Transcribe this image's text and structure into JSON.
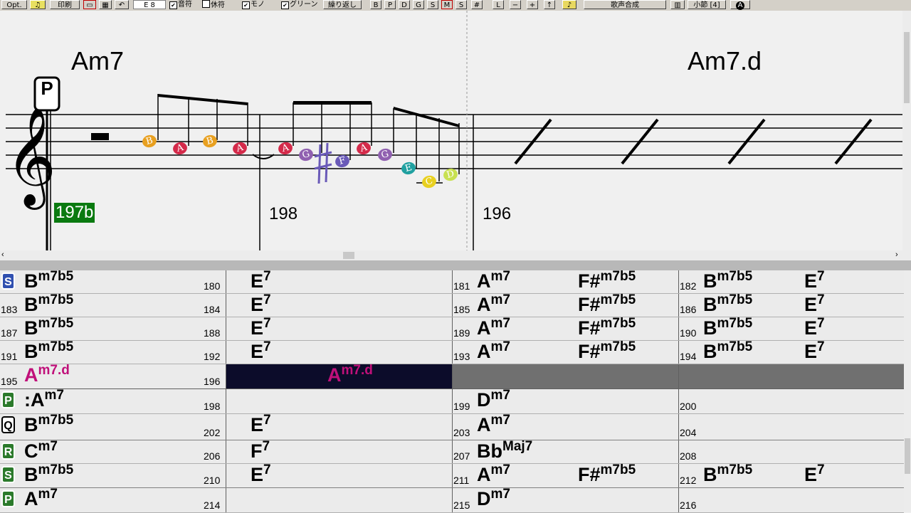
{
  "toolbar": {
    "opt_label": "Opt.",
    "print_label": "印刷",
    "key_value": "E 8",
    "check_note_name": "音符",
    "check_rest": "休符",
    "check_mono": "モノ",
    "check_green": "グリーン",
    "repeat_label": "繰り返し",
    "toggle_b": "B",
    "toggle_p": "P",
    "toggle_d": "D",
    "toggle_g": "G",
    "toggle_s": "S",
    "toggle_m": "M",
    "toggle_s2": "S",
    "sharp_label": "#",
    "l_label": "L",
    "minus_label": "−",
    "plus_label": "+",
    "up_label": "↑",
    "vocal_synth_label": "歌声合成",
    "bar_label": "小節 [4]",
    "a_label": "A"
  },
  "notation": {
    "chord_left": "Am7",
    "chord_right": "Am7.d",
    "current_measure": "197b",
    "measure_198": "198",
    "measure_196": "196",
    "part_marker": "P",
    "notes": [
      {
        "letter": "B",
        "color": "#e8a020"
      },
      {
        "letter": "A",
        "color": "#d42a4a"
      },
      {
        "letter": "B",
        "color": "#e8a020"
      },
      {
        "letter": "A",
        "color": "#d42a4a"
      },
      {
        "letter": "A",
        "color": "#d42a4a"
      },
      {
        "letter": "G",
        "color": "#9060b0"
      },
      {
        "letter": "F",
        "color": "#6a5ab8"
      },
      {
        "letter": "A",
        "color": "#d42a4a"
      },
      {
        "letter": "G",
        "color": "#9060b0"
      },
      {
        "letter": "E",
        "color": "#20a0a0"
      },
      {
        "letter": "C",
        "color": "#e8d020"
      },
      {
        "letter": "D",
        "color": "#c8e050"
      }
    ]
  },
  "sheet": {
    "rows": [
      {
        "marker": "S",
        "cells": [
          {
            "num": "",
            "c1": "B",
            "c1s": "m7b5",
            "c2": "",
            "c2s": ""
          },
          {
            "num": "180",
            "c1": "E",
            "c1s": "7",
            "c2": "",
            "c2s": ""
          },
          {
            "num": "181",
            "c1": "A",
            "c1s": "m7",
            "c2": "F#",
            "c2s": "m7b5"
          },
          {
            "num": "182",
            "c1": "B",
            "c1s": "m7b5",
            "c2": "E",
            "c2s": "7"
          }
        ]
      },
      {
        "marker": "",
        "cells": [
          {
            "num": "183",
            "c1": "B",
            "c1s": "m7b5",
            "c2": "",
            "c2s": ""
          },
          {
            "num": "184",
            "c1": "E",
            "c1s": "7",
            "c2": "",
            "c2s": ""
          },
          {
            "num": "185",
            "c1": "A",
            "c1s": "m7",
            "c2": "F#",
            "c2s": "m7b5"
          },
          {
            "num": "186",
            "c1": "B",
            "c1s": "m7b5",
            "c2": "E",
            "c2s": "7"
          }
        ]
      },
      {
        "marker": "",
        "cells": [
          {
            "num": "187",
            "c1": "B",
            "c1s": "m7b5",
            "c2": "",
            "c2s": ""
          },
          {
            "num": "188",
            "c1": "E",
            "c1s": "7",
            "c2": "",
            "c2s": ""
          },
          {
            "num": "189",
            "c1": "A",
            "c1s": "m7",
            "c2": "F#",
            "c2s": "m7b5"
          },
          {
            "num": "190",
            "c1": "B",
            "c1s": "m7b5",
            "c2": "E",
            "c2s": "7"
          }
        ]
      },
      {
        "marker": "",
        "cells": [
          {
            "num": "191",
            "c1": "B",
            "c1s": "m7b5",
            "c2": "",
            "c2s": ""
          },
          {
            "num": "192",
            "c1": "E",
            "c1s": "7",
            "c2": "",
            "c2s": ""
          },
          {
            "num": "193",
            "c1": "A",
            "c1s": "m7",
            "c2": "F#",
            "c2s": "m7b5"
          },
          {
            "num": "194",
            "c1": "B",
            "c1s": "m7b5",
            "c2": "E",
            "c2s": "7"
          }
        ]
      },
      {
        "marker": "",
        "cells": [
          {
            "num": "195",
            "c1": "A",
            "c1s": "m7.d",
            "c2": "",
            "c2s": ""
          },
          {
            "num": "196",
            "c1": "A",
            "c1s": "m7.d",
            "c2": "",
            "c2s": ""
          },
          {
            "num": "",
            "c1": "",
            "c1s": "",
            "c2": "",
            "c2s": ""
          },
          {
            "num": "",
            "c1": "",
            "c1s": "",
            "c2": "",
            "c2s": ""
          }
        ]
      },
      {
        "marker": "P",
        "cells": [
          {
            "num": "",
            "c1": ":A",
            "c1s": "m7",
            "c2": "",
            "c2s": ""
          },
          {
            "num": "198",
            "c1": "",
            "c1s": "",
            "c2": "",
            "c2s": ""
          },
          {
            "num": "199",
            "c1": "D",
            "c1s": "m7",
            "c2": "",
            "c2s": ""
          },
          {
            "num": "200",
            "c1": "",
            "c1s": "",
            "c2": "",
            "c2s": ""
          }
        ]
      },
      {
        "marker": "Q",
        "cells": [
          {
            "num": "",
            "c1": "B",
            "c1s": "m7b5",
            "c2": "",
            "c2s": ""
          },
          {
            "num": "202",
            "c1": "E",
            "c1s": "7",
            "c2": "",
            "c2s": ""
          },
          {
            "num": "203",
            "c1": "A",
            "c1s": "m7",
            "c2": "",
            "c2s": ""
          },
          {
            "num": "204",
            "c1": "",
            "c1s": "",
            "c2": "",
            "c2s": ""
          }
        ]
      },
      {
        "marker": "R",
        "cells": [
          {
            "num": "",
            "c1": "C",
            "c1s": "m7",
            "c2": "",
            "c2s": ""
          },
          {
            "num": "206",
            "c1": "F",
            "c1s": "7",
            "c2": "",
            "c2s": ""
          },
          {
            "num": "207",
            "c1": "Bb",
            "c1s": "Maj7",
            "c2": "",
            "c2s": ""
          },
          {
            "num": "208",
            "c1": "",
            "c1s": "",
            "c2": "",
            "c2s": ""
          }
        ]
      },
      {
        "marker": "S",
        "cells": [
          {
            "num": "",
            "c1": "B",
            "c1s": "m7b5",
            "c2": "",
            "c2s": ""
          },
          {
            "num": "210",
            "c1": "E",
            "c1s": "7",
            "c2": "",
            "c2s": ""
          },
          {
            "num": "211",
            "c1": "A",
            "c1s": "m7",
            "c2": "F#",
            "c2s": "m7b5"
          },
          {
            "num": "212",
            "c1": "B",
            "c1s": "m7b5",
            "c2": "E",
            "c2s": "7"
          }
        ]
      },
      {
        "marker": "P",
        "cells": [
          {
            "num": "",
            "c1": "A",
            "c1s": "m7",
            "c2": "",
            "c2s": ""
          },
          {
            "num": "214",
            "c1": "",
            "c1s": "",
            "c2": "",
            "c2s": ""
          },
          {
            "num": "215",
            "c1": "D",
            "c1s": "m7",
            "c2": "",
            "c2s": ""
          },
          {
            "num": "216",
            "c1": "",
            "c1s": "",
            "c2": "",
            "c2s": ""
          }
        ]
      }
    ]
  }
}
